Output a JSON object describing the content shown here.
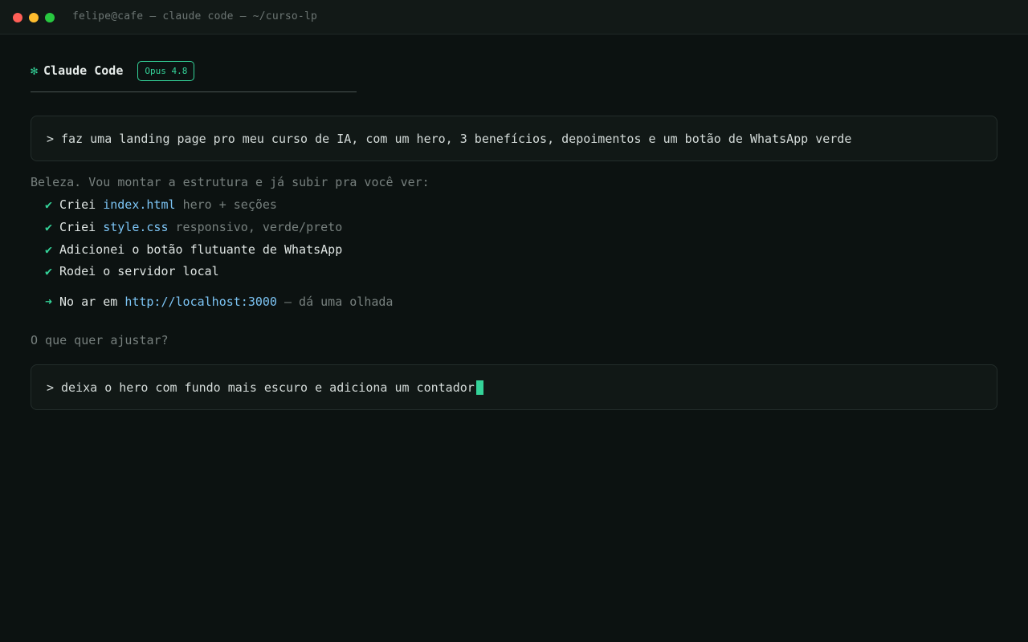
{
  "window": {
    "title": "felipe@cafe — claude code — ~/curso-lp"
  },
  "header": {
    "star_glyph": "✻",
    "app_name": "Claude Code",
    "model_badge": "Opus 4.8"
  },
  "conversation": {
    "user_prompt": "faz uma landing page pro meu curso de IA, com um hero, 3 benefícios, depoimentos e um botão de WhatsApp verde",
    "intro": "Beleza. Vou montar a estrutura e já subir pra você ver:",
    "steps": [
      {
        "verb": "Criei",
        "file": "index.html",
        "note": "hero + seções"
      },
      {
        "verb": "Criei",
        "file": "style.css",
        "note": "responsivo, verde/preto"
      },
      {
        "text": "Adicionei o botão flutuante de WhatsApp"
      },
      {
        "text": "Rodei o servidor local"
      }
    ],
    "check_glyph": "✔",
    "arrow_glyph": "➜",
    "live": {
      "prefix": "No ar em",
      "url": "http://localhost:3000",
      "suffix": "— dá uma olhada"
    },
    "question": "O que quer ajustar?"
  },
  "input": {
    "caret": ">",
    "current_value": "deixa o hero com fundo mais escuro e adiciona um contador"
  },
  "colors": {
    "accent": "#34d399",
    "background": "#0c1211",
    "link": "#7cc4f4",
    "muted": "#77807e"
  }
}
